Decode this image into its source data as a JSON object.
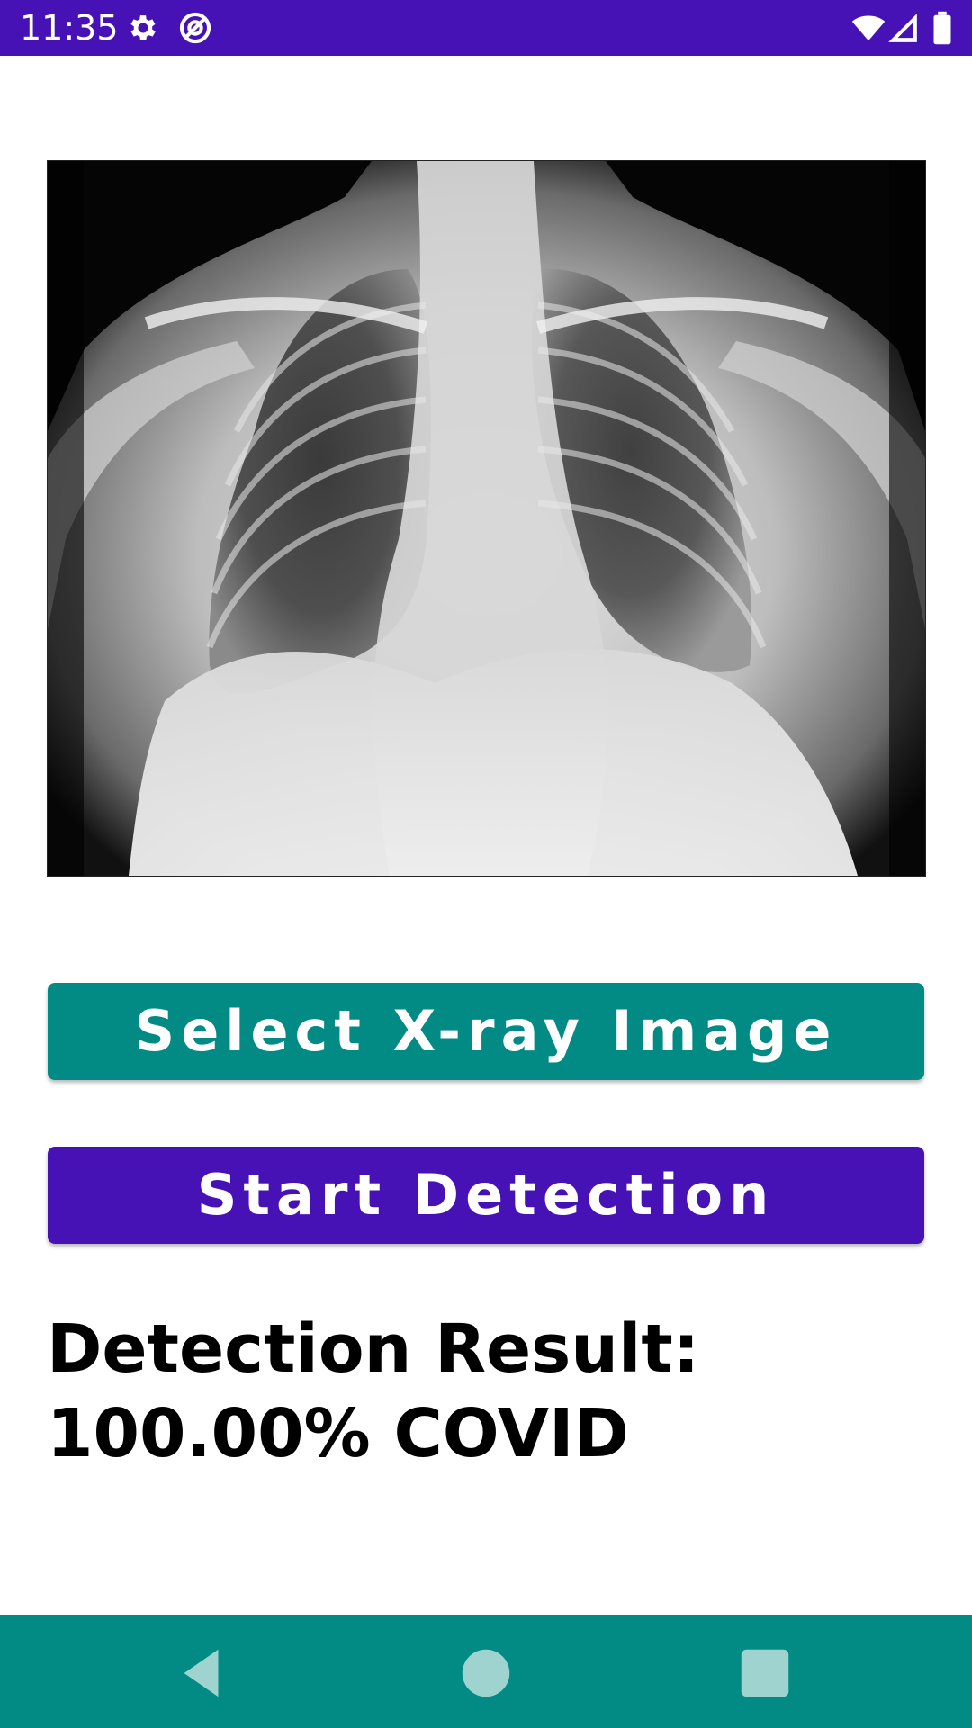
{
  "status_bar": {
    "time": "11:35",
    "icons_left": [
      "gear-icon",
      "no-sync-icon"
    ],
    "icons_right": [
      "wifi-icon",
      "cell-signal-icon",
      "battery-icon"
    ],
    "background": "#4612B6"
  },
  "main": {
    "image_description_icon": "chest-xray-image",
    "select_button_label": "Select X-ray Image",
    "start_button_label": "Start Detection",
    "result_text": "Detection Result:\n100.00% COVID",
    "colors": {
      "select_button": "#028A84",
      "start_button": "#4612B6"
    }
  },
  "nav_bar": {
    "icons": [
      "back-icon",
      "home-icon",
      "recents-icon"
    ],
    "background": "#028A84"
  }
}
